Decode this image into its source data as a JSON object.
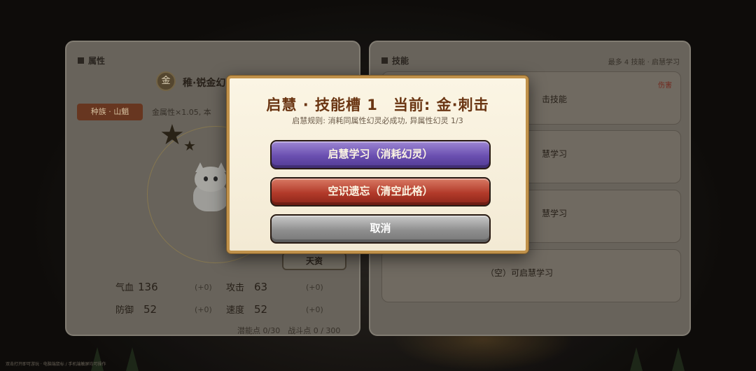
{
  "left_panel": {
    "header": "属性",
    "pet_badge": "金",
    "pet_name": "稚·锐金幻",
    "race_tag": "种族 · 山魈",
    "attr_note": "金属性×1.05, 本",
    "talent_button": "天资",
    "stats": [
      {
        "label": "气血",
        "value": "136",
        "delta": "(+0)"
      },
      {
        "label": "攻击",
        "value": "63",
        "delta": "(+0)"
      },
      {
        "label": "防御",
        "value": "52",
        "delta": "(+0)"
      },
      {
        "label": "速度",
        "value": "52",
        "delta": "(+0)"
      }
    ],
    "points": "潜能点 0/30　战斗点 0 / 300"
  },
  "right_panel": {
    "header": "技能",
    "tip": "最多 4 技能 · 启慧学习",
    "slots": [
      {
        "text": "击技能",
        "tag": "伤害"
      },
      {
        "text": "慧学习"
      },
      {
        "text": "慧学习"
      },
      {
        "text": "（空）可启慧学习"
      }
    ]
  },
  "modal": {
    "title": "启慧 · 技能槽 1　当前: 金·刺击",
    "rule": "启慧规则: 消耗同属性幻灵必成功, 异属性幻灵 1/3",
    "learn_button": "启慧学习（消耗幻灵）",
    "forget_button": "空识遗忘（清空此格）",
    "cancel_button": "取消"
  },
  "footer_hint": "双击打开即可游玩 · 电脑端鼠标 / 手机端触屏均可操作",
  "colors": {
    "modal_border": "#c0914a",
    "title": "#6a3512",
    "learn": "#6a4fb0",
    "forget": "#b23a2a",
    "cancel": "#8f8f8f"
  }
}
